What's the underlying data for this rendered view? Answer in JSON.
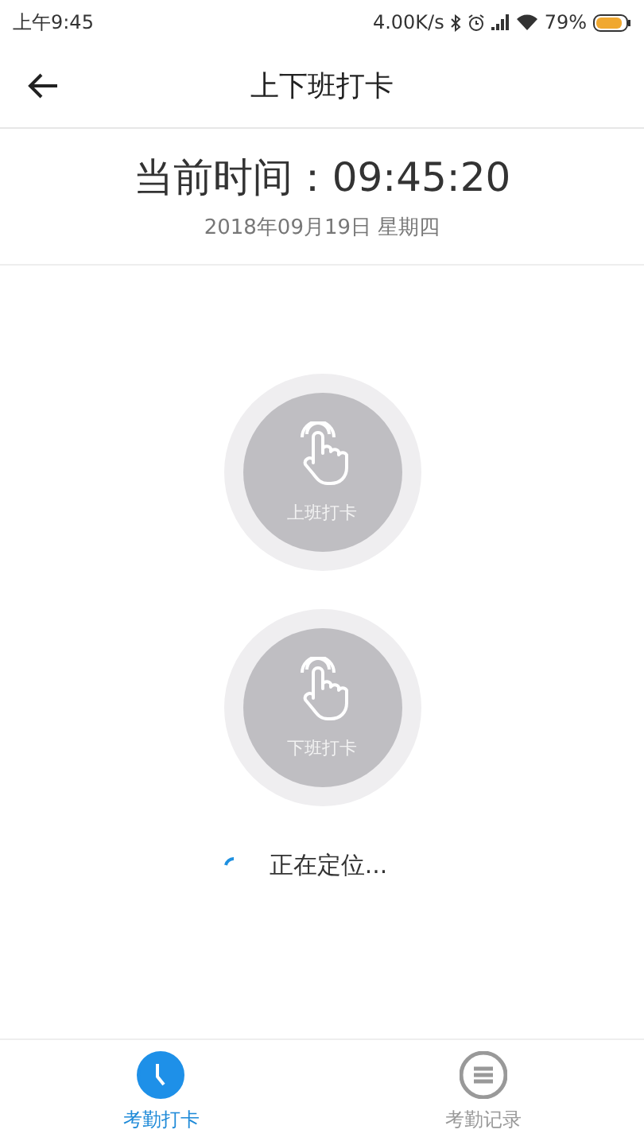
{
  "status_bar": {
    "time": "上午9:45",
    "speed": "4.00K/s",
    "battery": "79%"
  },
  "header": {
    "title": "上下班打卡"
  },
  "clock": {
    "label": "当前时间：09:45:20",
    "date": "2018年09月19日 星期四"
  },
  "punch_buttons": [
    {
      "label": "上班打卡",
      "disabled": true
    },
    {
      "label": "下班打卡",
      "disabled": true
    }
  ],
  "location_status": "正在定位...",
  "tabs": [
    {
      "label": "考勤打卡",
      "kind": "clock",
      "selected": true
    },
    {
      "label": "考勤记录",
      "kind": "list",
      "selected": false
    }
  ]
}
